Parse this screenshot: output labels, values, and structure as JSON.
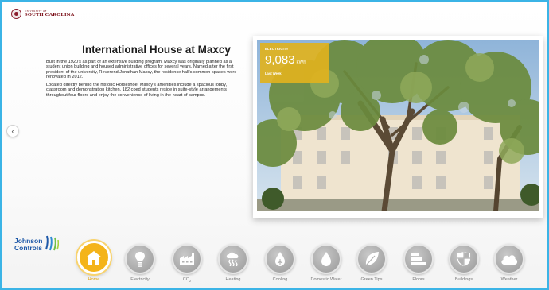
{
  "header": {
    "logo_small": "UNIVERSITY OF",
    "logo_big": "SOUTH CAROLINA"
  },
  "building": {
    "title": "International House at Maxcy",
    "paragraph1": "Built in the 1920's as part of an extensive building program, Maxcy was originally planned as a student union building and housed administrative offices for several years. Named after the first president of the university, Reverend Jonathan Maxcy, the residence hall's common spaces were renovated in 2012.",
    "paragraph2": "Located directly behind the historic Horseshoe, Maxcy's amenities include a spacious lobby, classroom and demonstration kitchen. 182 coed students reside in suite-style arrangements throughout four floors and enjoy the convenience of living in the heart of campus."
  },
  "energy_card": {
    "label": "ELECTRICITY",
    "value": "9,083",
    "unit": "kWh",
    "period": "Last Week"
  },
  "carousel": {
    "prev_glyph": "‹"
  },
  "footer_brand": {
    "line1": "Johnson",
    "line2": "Controls"
  },
  "nav": {
    "items": [
      {
        "label": "Home",
        "icon": "home-icon",
        "active": true
      },
      {
        "label": "Electricity",
        "icon": "lightbulb-icon"
      },
      {
        "label": "CO",
        "sub": "2",
        "icon": "factory-icon"
      },
      {
        "label": "Heating",
        "icon": "heating-icon"
      },
      {
        "label": "Cooling",
        "icon": "snowflake-drop-icon"
      },
      {
        "label": "Domestic Water",
        "icon": "water-drop-icon"
      },
      {
        "label": "Green Tips",
        "icon": "leaf-icon"
      },
      {
        "label": "Floors",
        "icon": "floors-icon"
      },
      {
        "label": "Buildings",
        "icon": "shield-icon"
      },
      {
        "label": "Weather",
        "icon": "cloud-icon"
      }
    ]
  },
  "colors": {
    "frame_border": "#3bb4e6",
    "accent": "#f4b41a",
    "energy_card": "#e0b21e",
    "brand_usc": "#73000a",
    "brand_jci": "#1d58a8"
  }
}
